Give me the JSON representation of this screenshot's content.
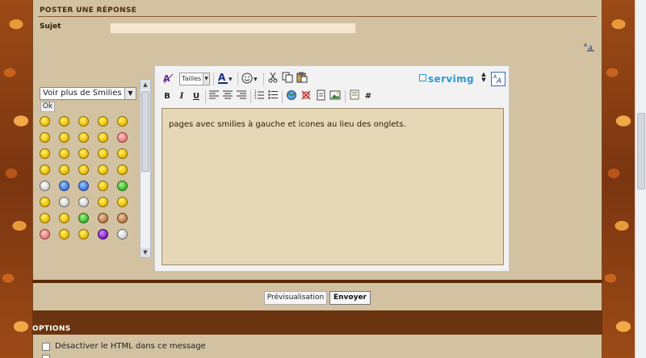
{
  "reply": {
    "section_title": "POSTER UNE RÉPONSE",
    "subject_label": "Sujet",
    "subject_value": ""
  },
  "smilies": {
    "select_value": "Voir plus de Smilies",
    "ok_label": "Ok",
    "rows": [
      [
        "yellow",
        "yellow",
        "yellow",
        "yellow",
        "yellow"
      ],
      [
        "yellow",
        "yellow",
        "yellow",
        "yellow",
        "pink"
      ],
      [
        "yellow",
        "yellow",
        "yellow",
        "yellow",
        "yellow"
      ],
      [
        "yellow",
        "yellow",
        "yellow",
        "yellow",
        "yellow"
      ],
      [
        "gray",
        "blue",
        "blue",
        "yellow",
        "green"
      ],
      [
        "yellow",
        "gray",
        "gray",
        "yellow",
        "yellow"
      ],
      [
        "yellow",
        "yellow",
        "green",
        "brown",
        "brown"
      ],
      [
        "pink",
        "yellow",
        "yellow",
        "purple",
        "gray"
      ]
    ]
  },
  "editor": {
    "tailles_label": "Tailles",
    "servimg_label": "servimg",
    "message_text": "pages avec smilies à gauche et icones au lieu des onglets.",
    "bold": "B",
    "italic": "I",
    "underline": "U",
    "hash": "#"
  },
  "actions": {
    "preview_label": "Prévisualisation",
    "send_label": "Envoyer"
  },
  "options": {
    "title": "OPTIONS",
    "disable_html_label": "Désactiver le HTML dans ce message"
  },
  "colors": {
    "panel": "#d2c2a2",
    "textarea": "#e6d7b6",
    "accent": "#2a9ad8",
    "options_bar": "#6a3410"
  }
}
